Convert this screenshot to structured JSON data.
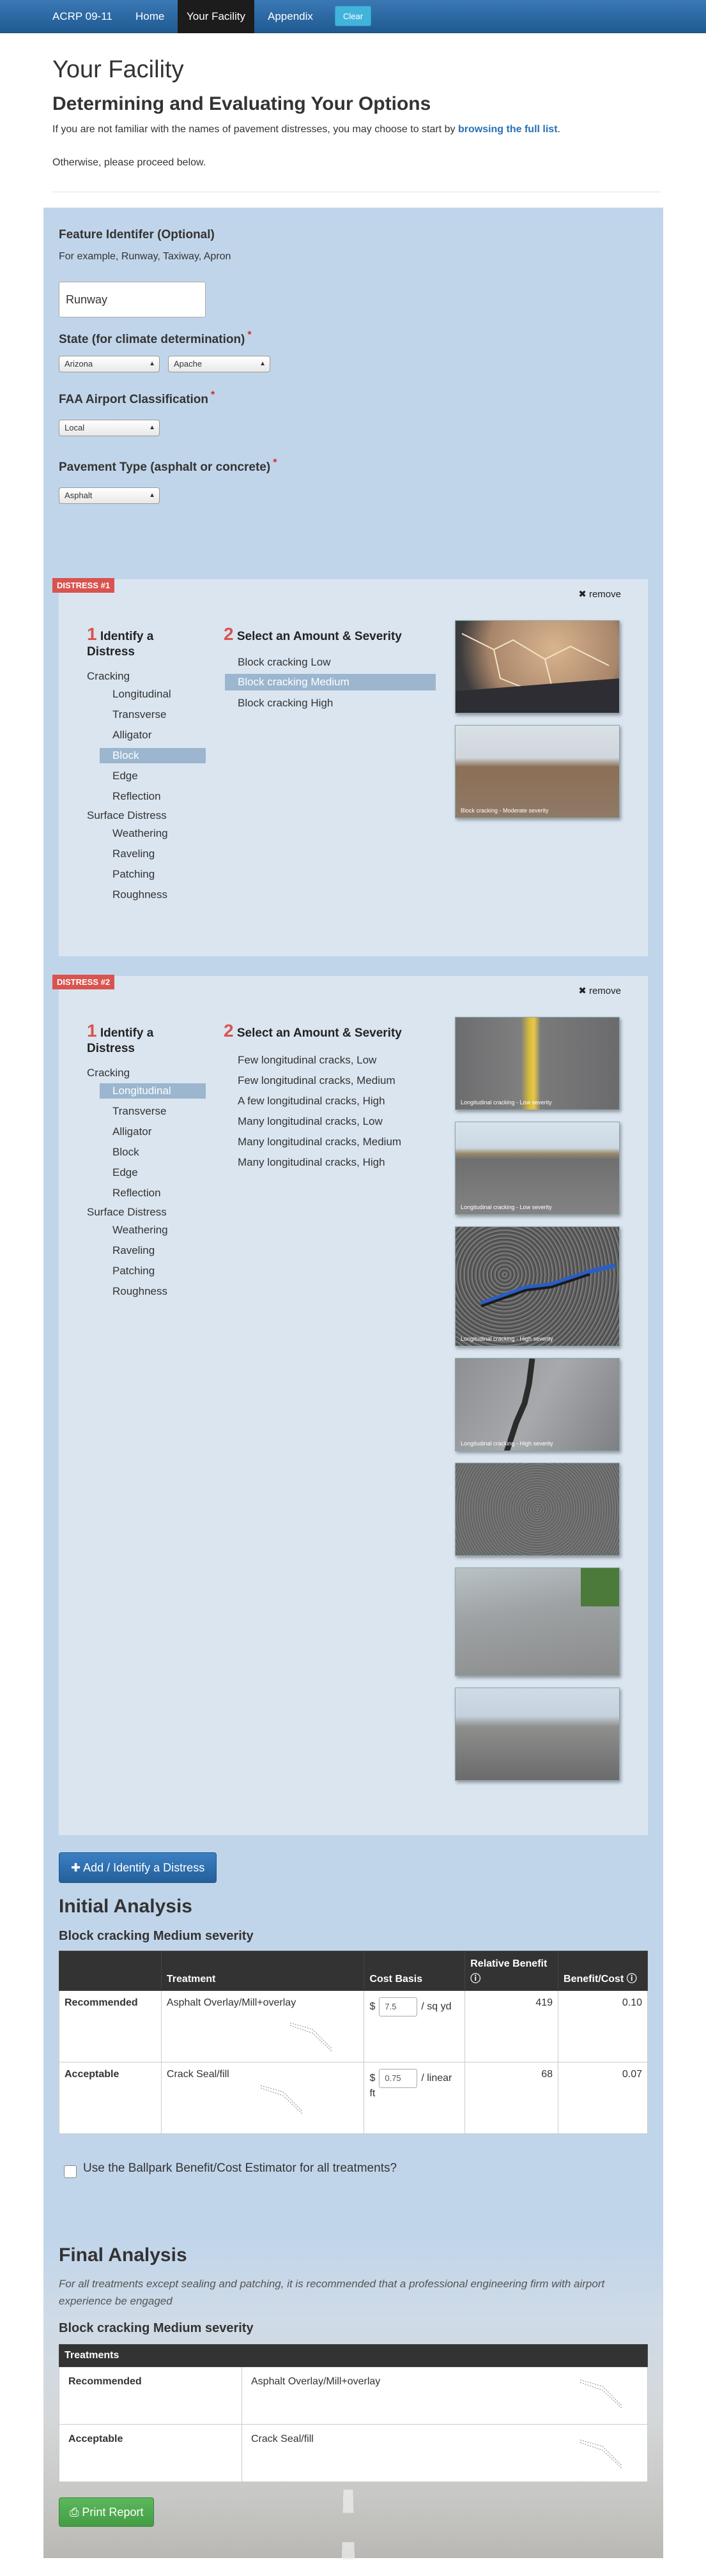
{
  "nav": {
    "brand": "ACRP 09-11",
    "items": [
      "Home",
      "Your Facility",
      "Appendix"
    ],
    "active": "Your Facility",
    "clear_label": "Clear"
  },
  "header": {
    "title": "Your Facility",
    "subtitle": "Determining and Evaluating Your Options",
    "intro_text": "If you are not familiar with the names of pavement distresses, you may choose to start by ",
    "intro_link": "browsing the full list",
    "intro_end": ".",
    "proceed": "Otherwise, please proceed below."
  },
  "form": {
    "feature_label": "Feature Identifer (Optional)",
    "feature_help": "For example, Runway, Taxiway, Apron",
    "feature_value": "Runway",
    "state_label": "State (for climate determination)",
    "state_value": "Arizona",
    "county_value": "Apache",
    "faa_label": "FAA Airport Classification",
    "faa_value": "Local",
    "pavement_label": "Pavement Type (asphalt or concrete)",
    "pavement_value": "Asphalt",
    "required_mark": "*"
  },
  "distress_common": {
    "step1_num": "1",
    "step1_title": "Identify a Distress",
    "step2_num": "2",
    "step2_title": "Select an Amount & Severity",
    "remove_label": "remove",
    "categories": [
      {
        "name": "Cracking",
        "items": [
          "Longitudinal",
          "Transverse",
          "Alligator",
          "Block",
          "Edge",
          "Reflection"
        ]
      },
      {
        "name": "Surface Distress",
        "items": [
          "Weathering",
          "Raveling",
          "Patching",
          "Roughness"
        ]
      }
    ]
  },
  "distress1": {
    "tag": "DISTRESS #1",
    "selected_item": "Block",
    "severities": [
      "Block cracking Low",
      "Block cracking Medium",
      "Block cracking High"
    ],
    "selected_severity": "Block cracking Medium",
    "photo_captions": [
      "",
      "Block cracking - Moderate severity"
    ]
  },
  "distress2": {
    "tag": "DISTRESS #2",
    "selected_item": "Longitudinal",
    "severities": [
      "Few longitudinal cracks, Low",
      "Few longitudinal cracks, Medium",
      "A few longitudinal cracks, High",
      "Many longitudinal cracks, Low",
      "Many longitudinal cracks, Medium",
      "Many longitudinal cracks, High"
    ],
    "photo_captions": [
      "Longitudinal cracking - Low severity",
      "Longitudinal cracking - Low severity",
      "Longitudinal cracking - High severity",
      "Longitudinal cracking - High severity",
      "",
      "",
      ""
    ]
  },
  "add_button": "Add / Identify a Distress",
  "initial": {
    "title": "Initial Analysis",
    "subtitle": "Block cracking Medium severity",
    "headers": [
      "",
      "Treatment",
      "Cost Basis",
      "Relative Benefit",
      "Benefit/Cost"
    ],
    "rows": [
      {
        "level": "Recommended",
        "treatment": "Asphalt Overlay/Mill+overlay",
        "currency": "$",
        "cost": "7.5",
        "unit": "/ sq yd",
        "benefit": "419",
        "ratio": "0.10"
      },
      {
        "level": "Acceptable",
        "treatment": "Crack Seal/fill",
        "currency": "$",
        "cost": "0.75",
        "unit": "/ linear ft",
        "benefit": "68",
        "ratio": "0.07"
      }
    ],
    "ballpark_label": "Use the Ballpark Benefit/Cost Estimator for all treatments?"
  },
  "final": {
    "title": "Final Analysis",
    "note": "For all treatments except sealing and patching, it is recommended that a professional engineering firm with airport experience be engaged",
    "subtitle": "Block cracking Medium severity",
    "table_header": "Treatments",
    "rows": [
      {
        "level": "Recommended",
        "treatment": "Asphalt Overlay/Mill+overlay"
      },
      {
        "level": "Acceptable",
        "treatment": "Crack Seal/fill"
      }
    ],
    "print_label": "Print Report"
  },
  "colors": {
    "nav": "#2a6aa8",
    "panel": "#c1d5ea",
    "distress_panel": "#dbe5f0",
    "selected": "#9bb6ce",
    "tag": "#d9534f",
    "primary": "#2f70b0",
    "success": "#5cb85c"
  },
  "icons": {
    "remove": "close-icon",
    "add": "plus-icon",
    "print": "print-icon",
    "info": "info-icon"
  }
}
